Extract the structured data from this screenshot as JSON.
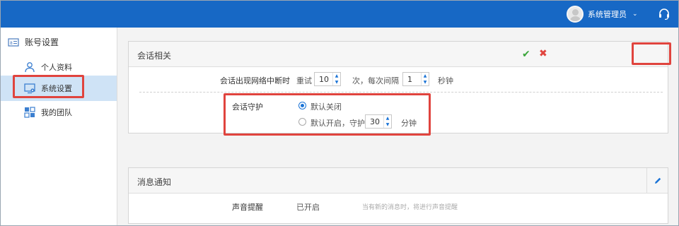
{
  "header": {
    "user_name": "系统管理员",
    "caret": "⌄",
    "accent": "#1768c5"
  },
  "sidebar": {
    "section_title": "账号设置",
    "items": [
      {
        "label": "个人资料",
        "icon": "user-icon"
      },
      {
        "label": "系统设置",
        "icon": "system-settings-icon",
        "active": true
      },
      {
        "label": "我的团队",
        "icon": "team-icon"
      }
    ]
  },
  "session_panel": {
    "title": "会话相关",
    "confirm_icon": "✔",
    "cancel_icon": "✖",
    "network_row": {
      "label": "会话出现网络中断时",
      "retry_prefix": "重试",
      "retry_count": "10",
      "retry_suffix": "次，每次间隔",
      "interval": "1",
      "interval_unit": "秒钟"
    },
    "guard_row": {
      "label": "会话守护",
      "option_off": "默认关闭",
      "option_on": "默认开启，守护",
      "minutes": "30",
      "minutes_unit": "分钟",
      "selected": "off"
    }
  },
  "message_panel": {
    "title": "消息通知",
    "sound_row": {
      "label": "声音提醒",
      "value": "已开启",
      "hint": "当有新的消息时，将进行声音提醒"
    }
  },
  "colors": {
    "highlight": "#e0443e",
    "active_bg": "#cfe3f6",
    "link_blue": "#1a73d6"
  }
}
